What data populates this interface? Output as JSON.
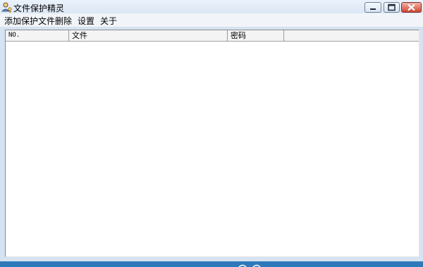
{
  "window": {
    "title": "文件保护精灵"
  },
  "menu": {
    "items": [
      "添加保护文件",
      "删除",
      "设置",
      "关于"
    ]
  },
  "table": {
    "columns": [
      "NO.",
      "文件",
      "密码"
    ],
    "rows": []
  },
  "colors": {
    "titlebar": "#dbe7f5",
    "close": "#cf4630",
    "frame": "#d6e3f2"
  },
  "icons": {
    "app": "person-with-key-icon"
  }
}
